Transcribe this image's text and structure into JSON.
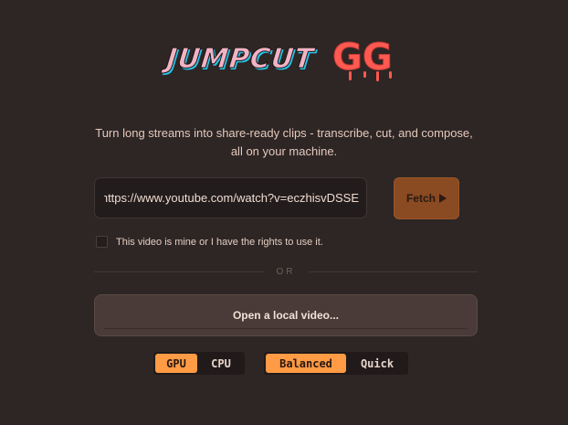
{
  "app": {
    "logo_text": "JUMPCUT",
    "logo_accent": "GG"
  },
  "tagline": {
    "line1": "Turn long streams into share-ready clips - transcribe, cut, and compose,",
    "line2": "all on your machine."
  },
  "url": {
    "value": "https://www.youtube.com/watch?v=eczhisvDSSE",
    "placeholder": ""
  },
  "fetch": {
    "label": "Fetch"
  },
  "rights": {
    "label": "This video is mine or I have the rights to use it.",
    "checked": false
  },
  "divider": {
    "label": "OR"
  },
  "open_local": {
    "label": "Open a local video..."
  },
  "device_toggle": {
    "options": [
      "GPU",
      "CPU"
    ],
    "selected": "GPU"
  },
  "mode_toggle": {
    "options": [
      "Balanced",
      "Quick"
    ],
    "selected": "Balanced"
  },
  "colors": {
    "background": "#2d2625",
    "accent": "#ff9a45",
    "fetch_button": "#8a4a22",
    "logo_pink": "#f2b3c4",
    "logo_cyan": "#27c3e6",
    "logo_red": "#ff5a52"
  },
  "icons": {
    "fetch": "play-triangle-icon"
  }
}
